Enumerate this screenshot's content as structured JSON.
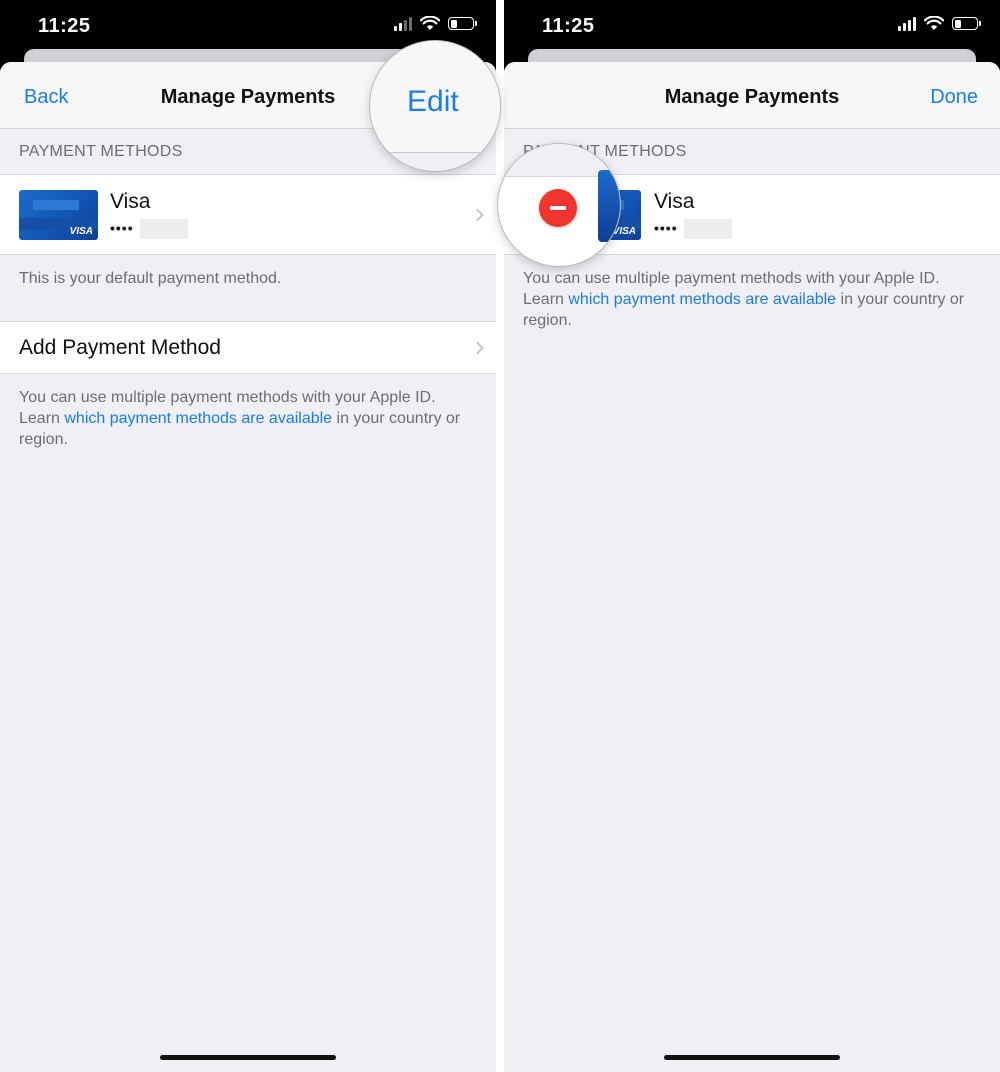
{
  "status_bar": {
    "time": "11:25"
  },
  "left_screen": {
    "nav": {
      "back_label": "Back",
      "title": "Manage Payments",
      "edit_label": "Edit"
    },
    "section_header": "PAYMENT METHODS",
    "card": {
      "name": "Visa",
      "masked_digits": "••••",
      "card_brand": "VISA"
    },
    "default_note": "This is your default payment method.",
    "add_payment_label": "Add Payment Method",
    "footer": {
      "text_before": "You can use multiple payment methods with your Apple ID. Learn ",
      "link": "which payment methods are available",
      "text_after": " in your country or region."
    }
  },
  "right_screen": {
    "nav": {
      "title": "Manage Payments",
      "done_label": "Done"
    },
    "section_header": "PAYMENT METHODS",
    "card": {
      "name": "Visa",
      "masked_digits": "••••",
      "card_brand": "VISA"
    },
    "footer": {
      "text_before": "You can use multiple payment methods with your Apple ID. Learn ",
      "link": "which payment methods are available",
      "text_after": " in your country or region."
    }
  },
  "icons": {
    "chevron": "chevron-right-icon",
    "delete": "minus-circle-icon",
    "wifi": "wifi-icon",
    "battery": "battery-icon",
    "signal": "cellular-signal-icon"
  },
  "colors": {
    "accent": "#1a7ce8",
    "delete_red": "#f0342f",
    "background": "#efeff4"
  }
}
